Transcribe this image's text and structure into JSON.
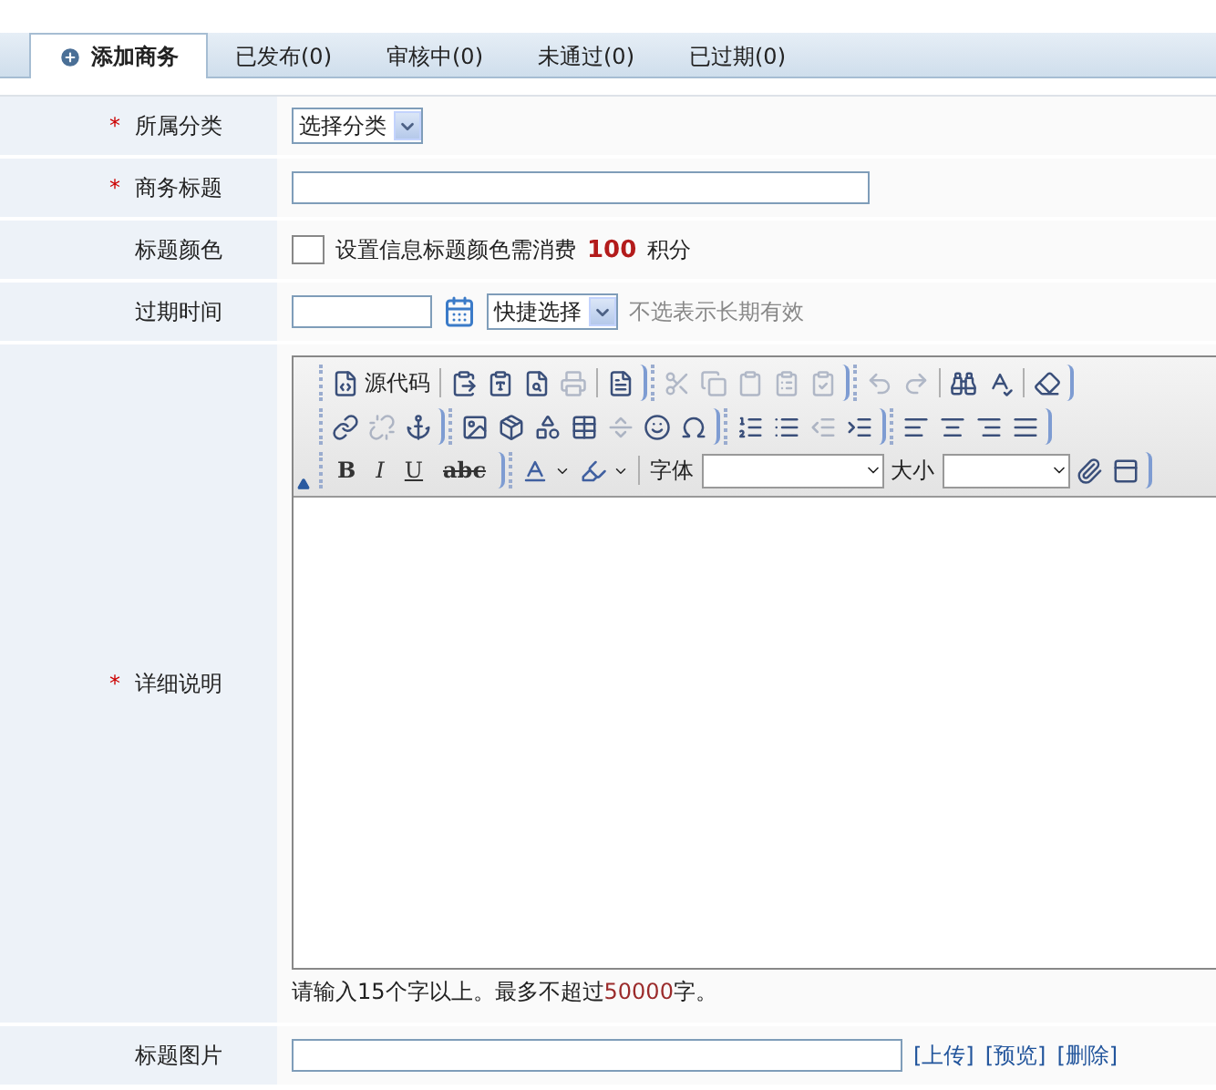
{
  "tabs": [
    {
      "label": "添加商务",
      "selected": true
    },
    {
      "label": "已发布(0)",
      "selected": false
    },
    {
      "label": "审核中(0)",
      "selected": false
    },
    {
      "label": "未通过(0)",
      "selected": false
    },
    {
      "label": "已过期(0)",
      "selected": false
    }
  ],
  "form": [
    {
      "kind": "select",
      "label": "所属分类",
      "required_mark": "*",
      "value": "选择分类"
    },
    {
      "kind": "text",
      "label": "商务标题",
      "required_mark": "*"
    },
    {
      "kind": "color",
      "label": "标题颜色",
      "note": "设置信息标题颜色需消费",
      "cost": "100",
      "unit": "积分"
    },
    {
      "kind": "date",
      "label": "过期时间",
      "quick_select": "快捷选择",
      "hint": "不选表示长期有效"
    },
    {
      "kind": "editor",
      "label": "详细说明",
      "required_mark": "*",
      "help_before": "请输入15个字以上。最多不超过",
      "help_limit": "50000",
      "help_after": "字。"
    },
    {
      "kind": "image",
      "label": "标题图片",
      "links": [
        "[上传]",
        "[预览]",
        "[删除]"
      ]
    }
  ],
  "toolbar": [
    {
      "groups": [
        [
          {
            "kind": "button",
            "label": "源代码",
            "disabled": false
          },
          {
            "kind": "divider"
          },
          {
            "kind": "button",
            "disabled": false
          },
          {
            "kind": "button",
            "disabled": false
          },
          {
            "kind": "button",
            "disabled": false
          },
          {
            "kind": "button",
            "disabled": true
          },
          {
            "kind": "divider"
          },
          {
            "kind": "button",
            "disabled": false
          }
        ],
        [
          {
            "kind": "button",
            "disabled": true
          },
          {
            "kind": "button",
            "disabled": true
          },
          {
            "kind": "button",
            "disabled": true
          },
          {
            "kind": "button",
            "disabled": true
          },
          {
            "kind": "button",
            "disabled": true
          }
        ],
        [
          {
            "kind": "button",
            "disabled": true
          },
          {
            "kind": "button",
            "disabled": true
          },
          {
            "kind": "divider"
          },
          {
            "kind": "button",
            "disabled": false
          },
          {
            "kind": "button",
            "disabled": false
          },
          {
            "kind": "divider"
          },
          {
            "kind": "button",
            "disabled": false
          }
        ]
      ]
    },
    {
      "groups": [
        [
          {
            "kind": "button",
            "disabled": false
          },
          {
            "kind": "button",
            "disabled": true
          },
          {
            "kind": "button",
            "disabled": false
          }
        ],
        [
          {
            "kind": "button",
            "disabled": false
          },
          {
            "kind": "button",
            "disabled": false
          },
          {
            "kind": "button",
            "disabled": false
          },
          {
            "kind": "button",
            "disabled": false
          },
          {
            "kind": "button",
            "disabled": true
          },
          {
            "kind": "button",
            "disabled": false
          },
          {
            "kind": "button",
            "disabled": false
          }
        ],
        [
          {
            "kind": "button",
            "disabled": false
          },
          {
            "kind": "button",
            "disabled": false
          },
          {
            "kind": "button",
            "disabled": true
          },
          {
            "kind": "button",
            "disabled": false
          }
        ],
        [
          {
            "kind": "button",
            "disabled": false
          },
          {
            "kind": "button",
            "disabled": false
          },
          {
            "kind": "button",
            "disabled": false
          },
          {
            "kind": "button",
            "disabled": false
          }
        ]
      ]
    },
    {
      "groups": [
        [
          {
            "kind": "text",
            "label": "B"
          },
          {
            "kind": "text",
            "label": "I"
          },
          {
            "kind": "text",
            "label": "U"
          },
          {
            "kind": "text",
            "label": "abc"
          }
        ],
        [
          {
            "kind": "menu"
          },
          {
            "kind": "menu"
          },
          {
            "kind": "divider"
          },
          {
            "kind": "label",
            "label": "字体"
          },
          {
            "kind": "select"
          },
          {
            "kind": "label",
            "label": "大小"
          },
          {
            "kind": "select"
          },
          {
            "kind": "button",
            "disabled": false
          },
          {
            "kind": "button",
            "disabled": false
          }
        ]
      ]
    }
  ]
}
